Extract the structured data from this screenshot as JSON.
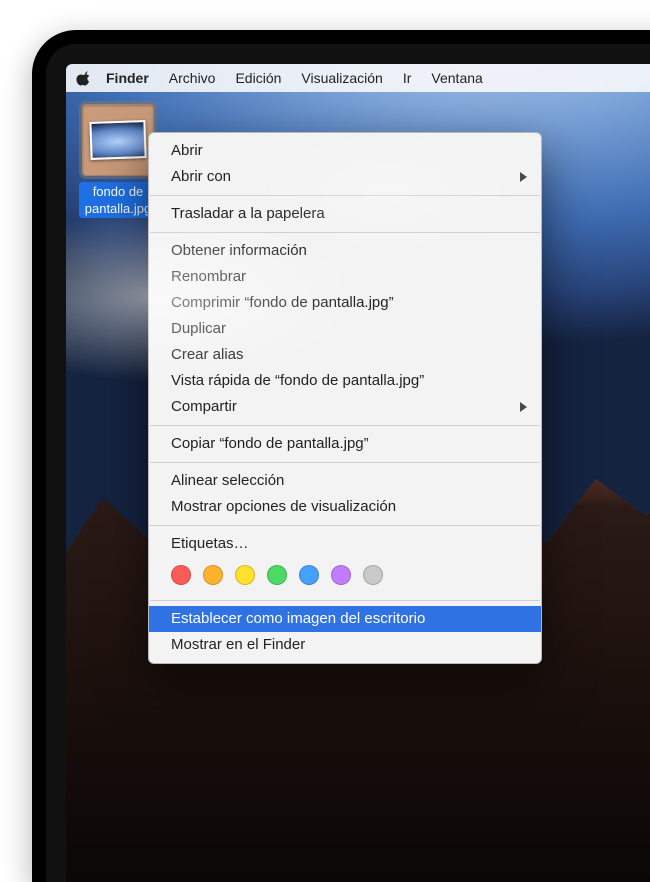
{
  "menubar": {
    "app": "Finder",
    "items": [
      "Archivo",
      "Edición",
      "Visualización",
      "Ir",
      "Ventana"
    ]
  },
  "desktop": {
    "file": {
      "name_line1": "fondo de",
      "name_line2": "pantalla.jpg"
    }
  },
  "context_menu": {
    "groups": [
      [
        {
          "label": "Abrir",
          "submenu": false
        },
        {
          "label": "Abrir con",
          "submenu": true
        }
      ],
      [
        {
          "label": "Trasladar a la papelera",
          "submenu": false
        }
      ],
      [
        {
          "label": "Obtener información",
          "submenu": false
        },
        {
          "label": "Renombrar",
          "submenu": false
        },
        {
          "label": "Comprimir “fondo de pantalla.jpg”",
          "submenu": false
        },
        {
          "label": "Duplicar",
          "submenu": false
        },
        {
          "label": "Crear alias",
          "submenu": false
        },
        {
          "label": "Vista rápida de “fondo de pantalla.jpg”",
          "submenu": false
        },
        {
          "label": "Compartir",
          "submenu": true
        }
      ],
      [
        {
          "label": "Copiar “fondo de pantalla.jpg”",
          "submenu": false
        }
      ],
      [
        {
          "label": "Alinear selección",
          "submenu": false
        },
        {
          "label": "Mostrar opciones de visualización",
          "submenu": false
        }
      ],
      [
        {
          "label": "Etiquetas…",
          "submenu": false
        }
      ]
    ],
    "tags": [
      "red",
      "orange",
      "yellow",
      "green",
      "blue",
      "purple",
      "gray"
    ],
    "footer": [
      {
        "label": "Establecer como imagen del escritorio",
        "highlight": true
      },
      {
        "label": "Mostrar en el Finder",
        "highlight": false
      }
    ]
  }
}
